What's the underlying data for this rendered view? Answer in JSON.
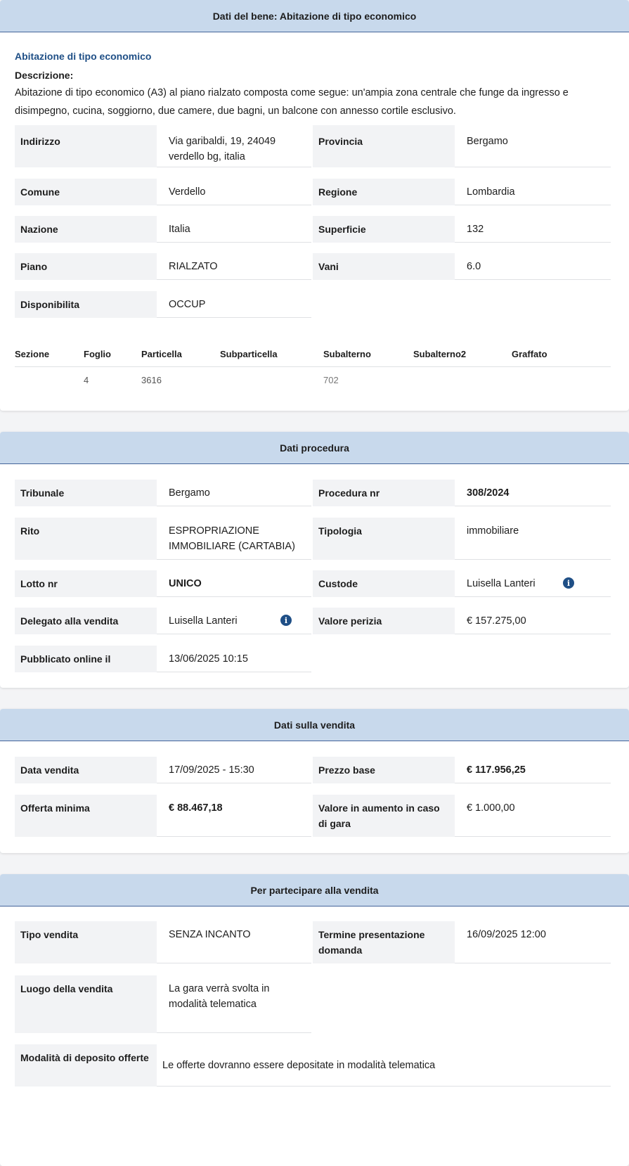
{
  "bene": {
    "header": "Dati del bene: Abitazione di tipo economico",
    "subtitle": "Abitazione di tipo economico",
    "desc_label": "Descrizione:",
    "desc_text": "Abitazione di tipo economico (A3) al piano rialzato composta come segue: un'ampia zona centrale che funge da ingresso e disimpegno, cucina, soggiorno, due camere, due bagni, un balcone con annesso cortile esclusivo.",
    "fields": {
      "indirizzo_label": "Indirizzo",
      "indirizzo_value": "Via garibaldi, 19, 24049 verdello bg, italia",
      "provincia_label": "Provincia",
      "provincia_value": "Bergamo",
      "comune_label": "Comune",
      "comune_value": "Verdello",
      "regione_label": "Regione",
      "regione_value": "Lombardia",
      "nazione_label": "Nazione",
      "nazione_value": "Italia",
      "superficie_label": "Superficie",
      "superficie_value": "132",
      "piano_label": "Piano",
      "piano_value": "RIALZATO",
      "vani_label": "Vani",
      "vani_value": "6.0",
      "disponibilita_label": "Disponibilita",
      "disponibilita_value": "OCCUP"
    },
    "catasto": {
      "headers": [
        "Sezione",
        "Foglio",
        "Particella",
        "Subparticella",
        "Subalterno",
        "Subalterno2",
        "Graffato"
      ],
      "row": [
        "",
        "4",
        "3616",
        "",
        "702",
        "",
        ""
      ]
    }
  },
  "procedura": {
    "header": "Dati procedura",
    "tribunale_label": "Tribunale",
    "tribunale_value": "Bergamo",
    "procedura_label": "Procedura nr",
    "procedura_value": "308/2024",
    "rito_label": "Rito",
    "rito_value": "ESPROPRIAZIONE IMMOBILIARE (CARTABIA)",
    "tipologia_label": "Tipologia",
    "tipologia_value": "immobiliare",
    "lotto_label": "Lotto nr",
    "lotto_value": "UNICO",
    "custode_label": "Custode",
    "custode_value": "Luisella Lanteri",
    "delegato_label": "Delegato alla vendita",
    "delegato_value": "Luisella Lanteri",
    "perizia_label": "Valore perizia",
    "perizia_value": "€ 157.275,00",
    "pubblicato_label": "Pubblicato online il",
    "pubblicato_value": "13/06/2025 10:15"
  },
  "vendita": {
    "header": "Dati sulla vendita",
    "data_label": "Data vendita",
    "data_value": "17/09/2025 - 15:30",
    "prezzo_label": "Prezzo base",
    "prezzo_value": "€ 117.956,25",
    "offerta_label": "Offerta minima",
    "offerta_value": "€ 88.467,18",
    "aumento_label": "Valore in aumento in caso di gara",
    "aumento_value": "€ 1.000,00"
  },
  "partecipare": {
    "header": "Per partecipare alla vendita",
    "tipo_label": "Tipo vendita",
    "tipo_value": "SENZA INCANTO",
    "termine_label": "Termine presentazione domanda",
    "termine_value": "16/09/2025 12:00",
    "luogo_label": "Luogo della vendita",
    "luogo_value": "La gara verrà svolta in modalità telematica",
    "deposito_label": "Modalità di deposito offerte",
    "deposito_value": "Le offerte dovranno essere depositate in modalità telematica"
  },
  "icons": {
    "info": "info-icon"
  },
  "colors": {
    "header_bg": "#c8d9ec",
    "header_border": "#44649a",
    "accent": "#1f4f86",
    "label_bg": "#f2f3f5"
  }
}
